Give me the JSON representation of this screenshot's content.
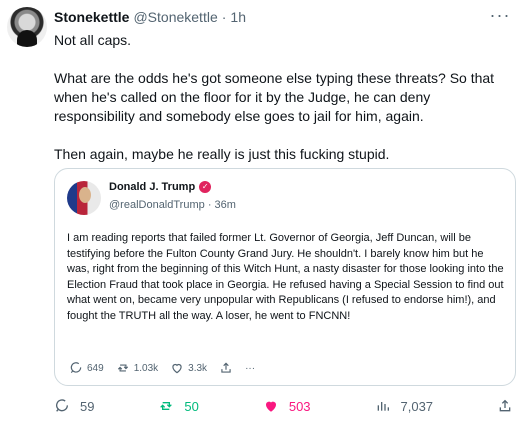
{
  "tweet": {
    "author_name": "Stonekettle",
    "author_handle": "@Stonekettle",
    "separator": "·",
    "time": "1h",
    "more_label": "···",
    "paragraphs": [
      "Not all caps.",
      "What are the odds he's got someone else typing these threats? So that when he's called on the floor for it by the Judge, he can deny responsibility and somebody else goes to jail for him, again.",
      "Then again, maybe he really is just this fucking stupid."
    ]
  },
  "quoted": {
    "author_name": "Donald J. Trump",
    "badge": "✓",
    "handle": "@realDonaldTrump",
    "separator": "·",
    "time": "36m",
    "text": "I am reading reports that failed former Lt. Governor of Georgia, Jeff Duncan, will be testifying before the Fulton County Grand Jury. He shouldn't. I barely know him but he was, right from the beginning of this Witch Hunt, a nasty disaster for those looking into the Election Fraud that took place in Georgia. He refused having a Special Session to find out what went on, became very unpopular with Republicans (I refused to endorse him!), and fought the TRUTH all the way. A loser, he went to FNCNN!",
    "stats": {
      "replies": "649",
      "retweets": "1.03k",
      "likes": "3.3k",
      "more": "···"
    }
  },
  "actions": {
    "replies": "59",
    "retweets": "50",
    "likes": "503",
    "views": "7,037"
  },
  "colors": {
    "text": "#0f1419",
    "muted": "#536471",
    "border": "#cfd9de",
    "retweet_green": "#00ba7c",
    "like_pink": "#f91880"
  },
  "icons": {
    "reply": "reply-icon",
    "retweet": "retweet-icon",
    "like": "heart-icon",
    "views": "views-icon",
    "share": "share-icon",
    "verified": "verified-badge-icon",
    "more": "more-icon"
  }
}
